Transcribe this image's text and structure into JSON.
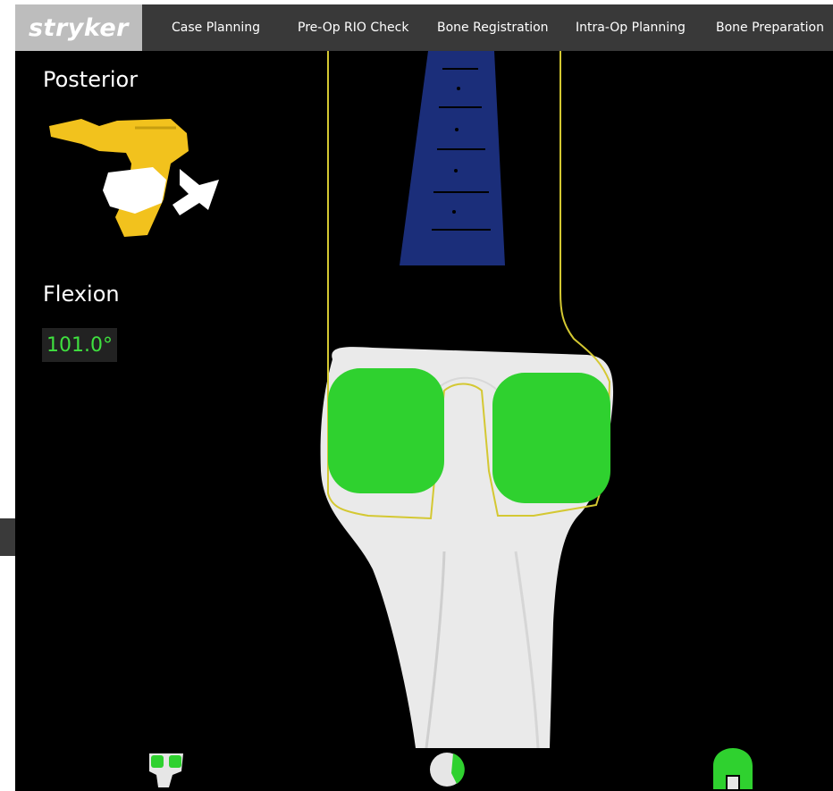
{
  "header": {
    "logo_text": "stryker",
    "tabs": [
      {
        "label": "Case Planning"
      },
      {
        "label": "Pre-Op RIO Check"
      },
      {
        "label": "Bone Registration"
      },
      {
        "label": "Intra-Op Planning"
      },
      {
        "label": "Bone Preparation"
      }
    ]
  },
  "panel": {
    "view_label": "Posterior",
    "flexion_label": "Flexion",
    "flexion_value": "101.0°"
  },
  "bottom_views": [
    {
      "icon": "tibia-implant-view-icon"
    },
    {
      "icon": "patella-view-icon"
    },
    {
      "icon": "femur-implant-view-icon"
    }
  ],
  "colors": {
    "accent_green": "#2fd12f",
    "header_bg": "#393939",
    "logo_bg": "#bdbdbd",
    "trajectory_blue": "#1b2e7a",
    "outline_yellow": "#d4c832"
  }
}
